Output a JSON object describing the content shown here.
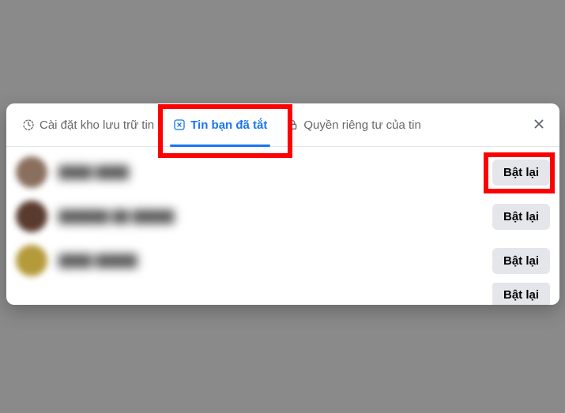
{
  "tabs": {
    "archive": {
      "label": "Cài đặt kho lưu trữ tin"
    },
    "muted": {
      "label": "Tin bạn đã tắt"
    },
    "privacy": {
      "label": "Quyền riêng tư của tin"
    }
  },
  "action_label": "Bật lại",
  "list": [
    {
      "name": "████ ████"
    },
    {
      "name": "██████ ██ █████"
    },
    {
      "name": "████ █████"
    },
    {
      "name": "████"
    }
  ]
}
